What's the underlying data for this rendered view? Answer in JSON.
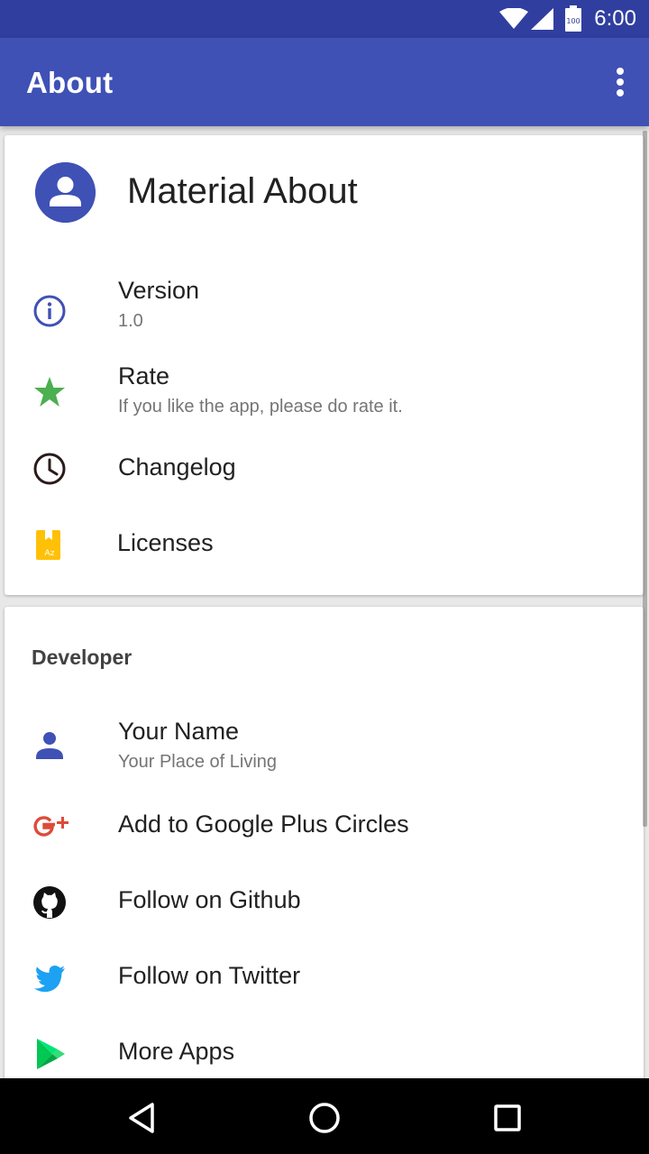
{
  "status_bar": {
    "time": "6:00",
    "battery_level": "100",
    "icons": [
      "wifi-icon",
      "cell-signal-icon",
      "battery-icon"
    ]
  },
  "app_bar": {
    "title": "About",
    "overflow_icon": "more-vert-icon",
    "background_color": "#3f51b5"
  },
  "app_card": {
    "app_name": "Material About",
    "items": [
      {
        "icon": "info-icon",
        "title": "Version",
        "subtitle": "1.0"
      },
      {
        "icon": "star-icon",
        "title": "Rate",
        "subtitle": "If you like the app, please do rate it."
      },
      {
        "icon": "clock-icon",
        "title": "Changelog"
      },
      {
        "icon": "license-book-icon",
        "title": "Licenses"
      }
    ]
  },
  "developer_card": {
    "section_title": "Developer",
    "items": [
      {
        "icon": "person-icon",
        "title": "Your Name",
        "subtitle": "Your Place of Living"
      },
      {
        "icon": "google-plus-icon",
        "title": "Add to Google Plus Circles"
      },
      {
        "icon": "github-icon",
        "title": "Follow on Github"
      },
      {
        "icon": "twitter-icon",
        "title": "Follow on Twitter"
      },
      {
        "icon": "play-store-icon",
        "title": "More Apps"
      }
    ]
  },
  "nav_bar": {
    "buttons": [
      "back-icon",
      "home-icon",
      "recents-icon"
    ]
  },
  "colors": {
    "primary": "#3f51b5",
    "primary_dark": "#303f9f",
    "star": "#4caf50",
    "license": "#ffc107",
    "google_plus": "#dd4b39",
    "twitter": "#1da1f2"
  }
}
